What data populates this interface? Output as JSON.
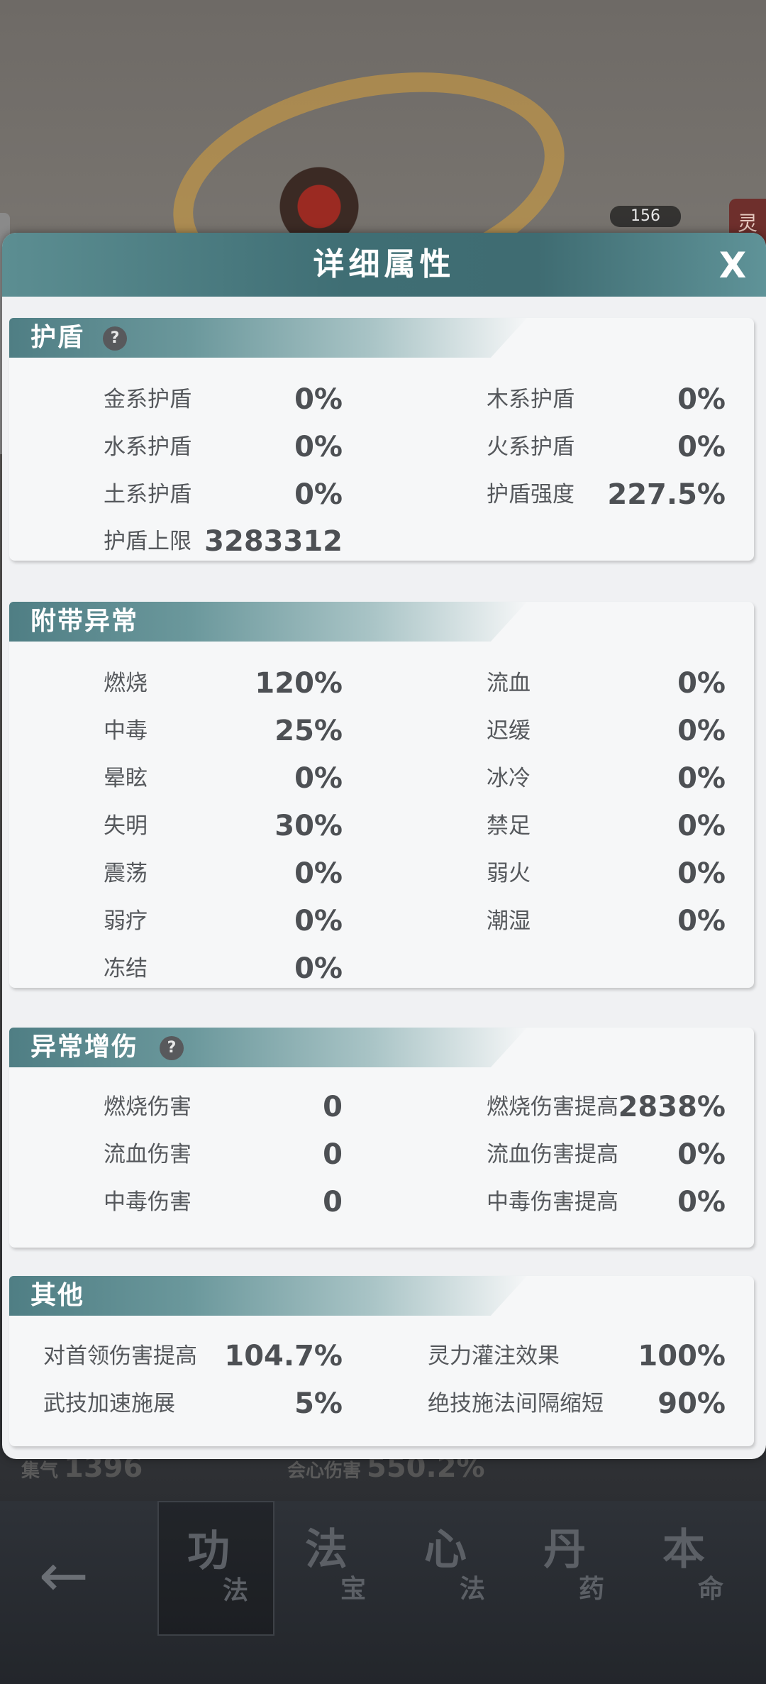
{
  "background": {
    "badge_count": "156",
    "side_tag": "灵",
    "stat_left_label": "集气",
    "stat_left_value": "1396",
    "stat_right_label": "会心伤害",
    "stat_right_value": "550.2%"
  },
  "bottom_nav": {
    "back_icon": "arrow-left-icon",
    "tabs": [
      {
        "big": "功",
        "small": "法",
        "active": true
      },
      {
        "big": "法",
        "small": "宝",
        "active": false
      },
      {
        "big": "心",
        "small": "法",
        "active": false
      },
      {
        "big": "丹",
        "small": "药",
        "active": false
      },
      {
        "big": "本",
        "small": "命",
        "active": false
      }
    ]
  },
  "modal": {
    "title": "详细属性",
    "close_label": "X"
  },
  "sections": {
    "shield": {
      "title": "护盾",
      "help": "?",
      "left": [
        {
          "label": "金系护盾",
          "value": "0%"
        },
        {
          "label": "水系护盾",
          "value": "0%"
        },
        {
          "label": "土系护盾",
          "value": "0%"
        },
        {
          "label": "护盾上限",
          "value": "3283312"
        }
      ],
      "right": [
        {
          "label": "木系护盾",
          "value": "0%"
        },
        {
          "label": "火系护盾",
          "value": "0%"
        },
        {
          "label": "护盾强度",
          "value": "227.5%"
        }
      ]
    },
    "abnormal": {
      "title": "附带异常",
      "left": [
        {
          "label": "燃烧",
          "value": "120%"
        },
        {
          "label": "中毒",
          "value": "25%"
        },
        {
          "label": "晕眩",
          "value": "0%"
        },
        {
          "label": "失明",
          "value": "30%"
        },
        {
          "label": "震荡",
          "value": "0%"
        },
        {
          "label": "弱疗",
          "value": "0%"
        },
        {
          "label": "冻结",
          "value": "0%"
        }
      ],
      "right": [
        {
          "label": "流血",
          "value": "0%"
        },
        {
          "label": "迟缓",
          "value": "0%"
        },
        {
          "label": "冰冷",
          "value": "0%"
        },
        {
          "label": "禁足",
          "value": "0%"
        },
        {
          "label": "弱火",
          "value": "0%"
        },
        {
          "label": "潮湿",
          "value": "0%"
        }
      ]
    },
    "abnormal_damage": {
      "title": "异常增伤",
      "help": "?",
      "left": [
        {
          "label": "燃烧伤害",
          "value": "0"
        },
        {
          "label": "流血伤害",
          "value": "0"
        },
        {
          "label": "中毒伤害",
          "value": "0"
        }
      ],
      "right": [
        {
          "label": "燃烧伤害提高",
          "value": "2838%"
        },
        {
          "label": "流血伤害提高",
          "value": "0%"
        },
        {
          "label": "中毒伤害提高",
          "value": "0%"
        }
      ]
    },
    "other": {
      "title": "其他",
      "left": [
        {
          "label": "对首领伤害提高",
          "value": "104.7%"
        },
        {
          "label": "武技加速施展",
          "value": "5%"
        }
      ],
      "right": [
        {
          "label": "灵力灌注效果",
          "value": "100%"
        },
        {
          "label": "绝技施法间隔缩短",
          "value": "90%"
        }
      ]
    }
  }
}
